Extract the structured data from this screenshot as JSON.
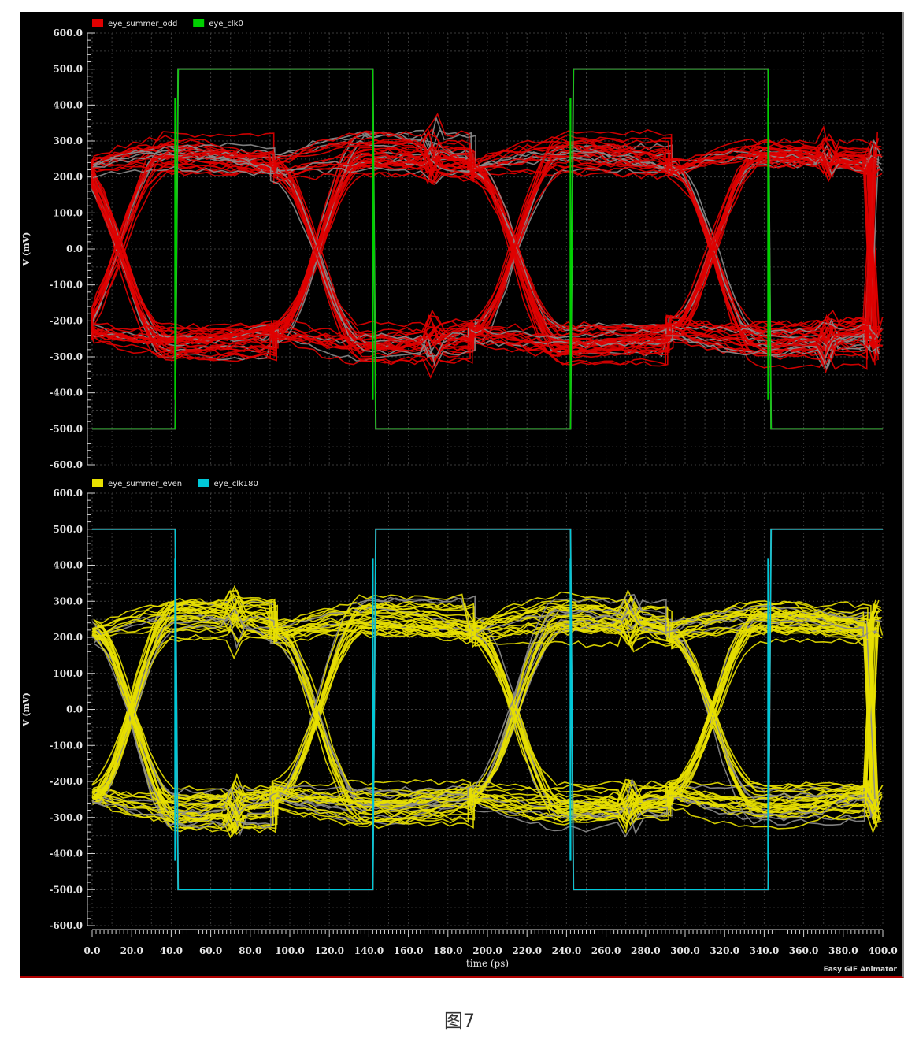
{
  "figure": {
    "caption": "图7",
    "watermark": "Easy GIF Animator"
  },
  "colors": {
    "background": "#000000",
    "grid": "#3a3a3a",
    "axis": "#d0d0d0",
    "trace_gray": "#8c8c8c"
  },
  "chart_data": [
    {
      "type": "line",
      "title": "",
      "xlabel": "",
      "ylabel": "V (mV)",
      "xlim": [
        0,
        400
      ],
      "ylim": [
        -600,
        600
      ],
      "y_ticks": [
        "600.0",
        "500.0",
        "400.0",
        "300.0",
        "200.0",
        "100.0",
        "0.0",
        "-100.0",
        "-200.0",
        "-300.0",
        "-400.0",
        "-500.0",
        "-600.0"
      ],
      "grid": true,
      "legend_position": "top-left",
      "legend": [
        {
          "name": "eye_summer_odd",
          "color": "#e00000"
        },
        {
          "name": "eye_clk0",
          "color": "#00d000"
        }
      ],
      "clock": {
        "name": "eye_clk0",
        "color": "#00d000",
        "high_mv": 500,
        "low_mv": -500,
        "rising_edges_ps": [
          42,
          242
        ],
        "falling_edges_ps": [
          142,
          342
        ]
      },
      "eye": {
        "name": "eye_summer_odd",
        "color": "#e00000",
        "crossings_ps": [
          -8,
          92,
          192,
          292,
          392
        ],
        "level_mv": [
          -250,
          -200,
          200,
          250
        ],
        "eye_peak_mv": [
          170,
          180
        ],
        "overshoot_peak_mv": 350,
        "discontinuity_ps": [
          172,
          372
        ],
        "mean_offset_mv": 0
      }
    },
    {
      "type": "line",
      "title": "",
      "xlabel": "time (ps)",
      "ylabel": "V (mV)",
      "xlim": [
        0,
        400
      ],
      "ylim": [
        -600,
        600
      ],
      "y_ticks": [
        "600.0",
        "500.0",
        "400.0",
        "300.0",
        "200.0",
        "100.0",
        "0.0",
        "-100.0",
        "-200.0",
        "-300.0",
        "-400.0",
        "-500.0",
        "-600.0"
      ],
      "x_ticks": [
        "0.0",
        "20.0",
        "40.0",
        "60.0",
        "80.0",
        "100.0",
        "120.0",
        "140.0",
        "160.0",
        "180.0",
        "200.0",
        "220.0",
        "240.0",
        "260.0",
        "280.0",
        "300.0",
        "320.0",
        "340.0",
        "360.0",
        "380.0",
        "400.0"
      ],
      "grid": true,
      "legend_position": "top-left",
      "legend": [
        {
          "name": "eye_summer_even",
          "color": "#e8e000"
        },
        {
          "name": "eye_clk180",
          "color": "#00c8d8"
        }
      ],
      "clock": {
        "name": "eye_clk180",
        "color": "#00c8d8",
        "high_mv": 500,
        "low_mv": -500,
        "rising_edges_ps": [
          142,
          342
        ],
        "falling_edges_ps": [
          42,
          242
        ]
      },
      "eye": {
        "name": "eye_summer_even",
        "color": "#e8e000",
        "crossings_ps": [
          0,
          92,
          192,
          292,
          392
        ],
        "level_mv": [
          -250,
          -200,
          200,
          250
        ],
        "eye_peak_mv": [
          170,
          180
        ],
        "overshoot_peak_mv": 350,
        "discontinuity_ps": [
          72,
          272
        ],
        "mean_offset_mv": -10
      }
    }
  ]
}
